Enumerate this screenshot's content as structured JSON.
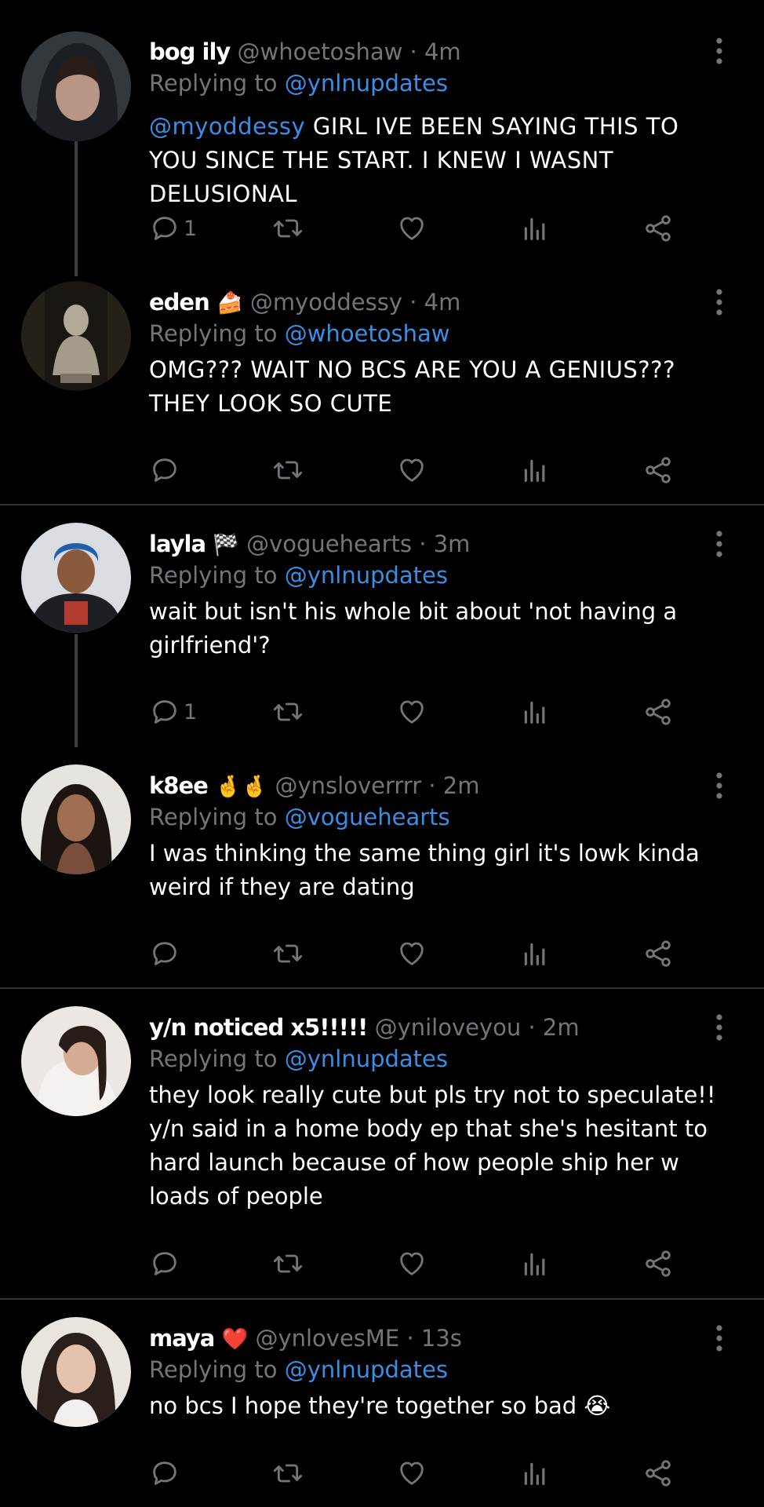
{
  "colors": {
    "background": "#000000",
    "mention": "#3a8ee6",
    "secondary_text": "#71767b",
    "divider": "#2f3336"
  },
  "tweets": [
    {
      "name": "bog ily",
      "name_emoji": "",
      "handle": "@whoetoshaw",
      "dot": "·",
      "time": "4m",
      "replying_prefix": "Replying to",
      "replying_to": "@ynlnupdates",
      "body_mention": "@myoddessy",
      "body": " GIRL IVE BEEN SAYING THIS TO YOU SINCE THE START. I KNEW I WASNT DELUSIONAL",
      "reply_count": "1",
      "icons": [
        "reply-icon",
        "retweet-icon",
        "like-icon",
        "views-icon",
        "share-icon",
        "more-icon"
      ]
    },
    {
      "name": "eden",
      "name_emoji": "🍰",
      "handle": "@myoddessy",
      "dot": "·",
      "time": "4m",
      "replying_prefix": "Replying to",
      "replying_to": "@whoetoshaw",
      "body": "OMG??? WAIT NO BCS ARE YOU A GENIUS??? THEY LOOK SO CUTE",
      "reply_count": ""
    },
    {
      "name": "layla",
      "name_emoji": "🏁",
      "handle": "@voguehearts",
      "dot": "·",
      "time": "3m",
      "replying_prefix": "Replying to",
      "replying_to": "@ynlnupdates",
      "body": "wait but isn't his whole bit about 'not having a girlfriend'?",
      "reply_count": "1"
    },
    {
      "name": "k8ee",
      "name_emoji": "🤞🤞",
      "handle": "@ynsloverrrr",
      "dot": "·",
      "time": "2m",
      "replying_prefix": "Replying to",
      "replying_to": "@voguehearts",
      "body": "I was thinking the same thing girl it's lowk kinda weird if they are dating",
      "reply_count": ""
    },
    {
      "name": "y/n noticed x5!!!!!",
      "name_emoji": "",
      "handle": "@yniloveyou",
      "dot": "·",
      "time": "2m",
      "replying_prefix": "Replying to",
      "replying_to": "@ynlnupdates",
      "body": "they look really cute but pls try not to speculate!! y/n said in a home body ep that she's hesitant to hard launch because of how people ship her w loads of people",
      "reply_count": ""
    },
    {
      "name": "maya",
      "name_emoji": "❤️",
      "handle": "@ynlovesME",
      "dot": "·",
      "time": "13s",
      "replying_prefix": "Replying to",
      "replying_to": "@ynlnupdates",
      "body": "no bcs I hope they're together so bad 😭",
      "reply_count": ""
    }
  ]
}
